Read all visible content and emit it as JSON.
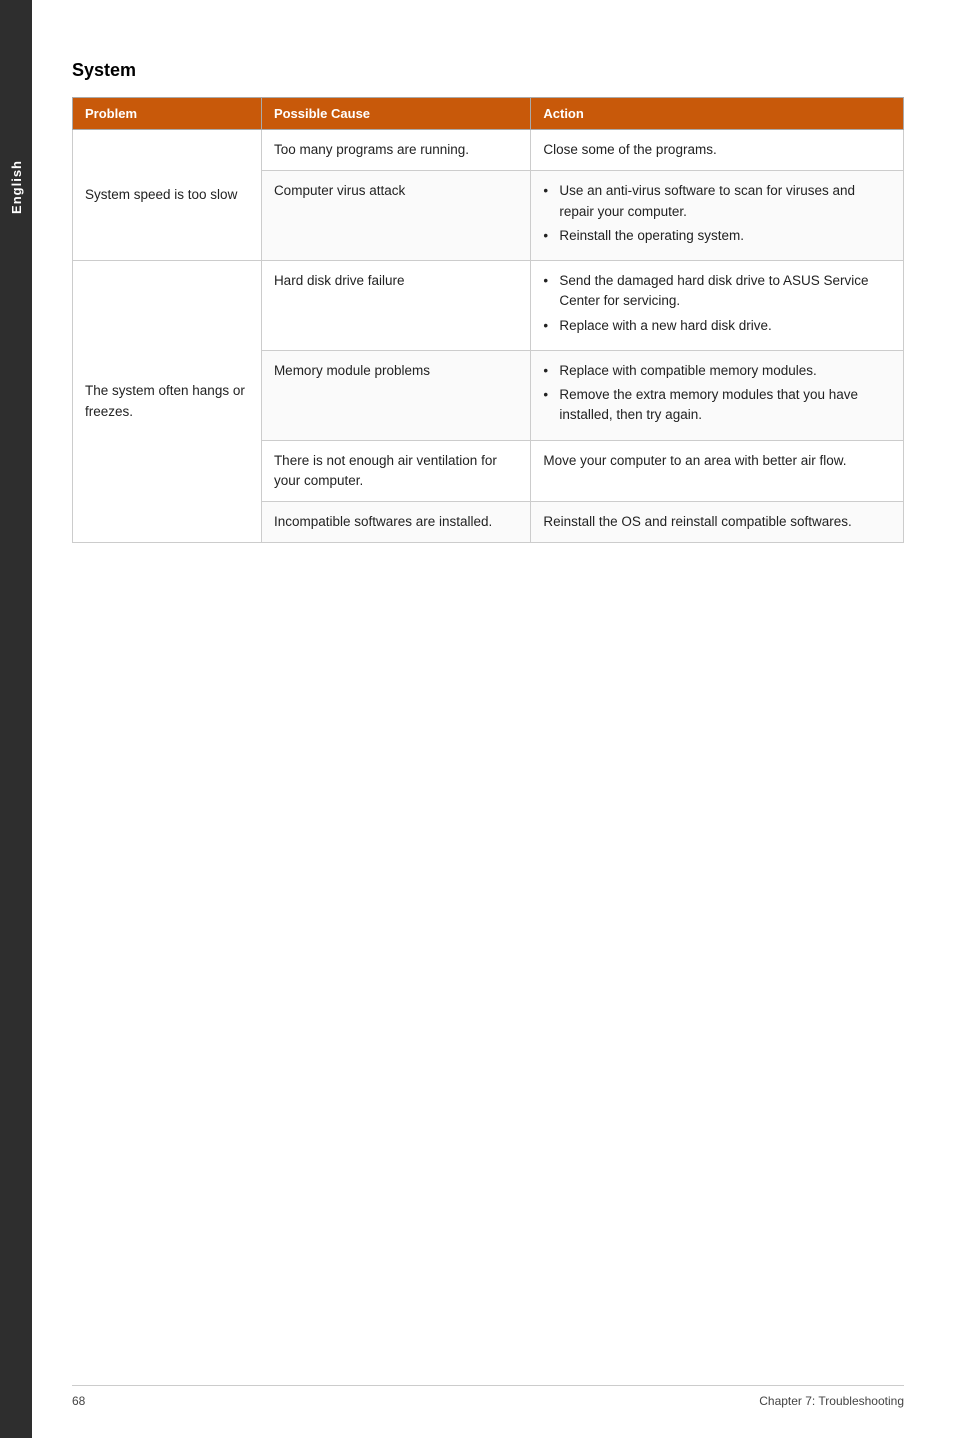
{
  "side_tab": {
    "label": "English"
  },
  "section_title": "System",
  "table": {
    "headers": [
      "Problem",
      "Possible Cause",
      "Action"
    ],
    "rows": [
      {
        "problem": "System speed is too slow",
        "possible_cause": "Too many programs are running.",
        "action_text": "Close some of the programs.",
        "action_type": "plain"
      },
      {
        "problem": "",
        "possible_cause": "Computer virus attack",
        "action_type": "bullets",
        "action_bullets": [
          "Use an anti-virus software to scan for viruses and repair your computer.",
          "Reinstall the operating system."
        ]
      },
      {
        "problem": "The system often hangs or freezes.",
        "possible_cause": "Hard disk drive failure",
        "action_type": "bullets",
        "action_bullets": [
          "Send the damaged hard disk drive to ASUS Service Center for servicing.",
          "Replace with a new hard disk drive."
        ]
      },
      {
        "problem": "",
        "possible_cause": "Memory module problems",
        "action_type": "bullets",
        "action_bullets": [
          "Replace with compatible memory modules.",
          "Remove the extra memory modules that you have installed, then try again."
        ]
      },
      {
        "problem": "",
        "possible_cause": "There is not enough air ventilation for your computer.",
        "action_text": "Move your computer to an area with better air flow.",
        "action_type": "plain"
      },
      {
        "problem": "",
        "possible_cause": "Incompatible softwares are installed.",
        "action_text": "Reinstall the OS and reinstall compatible softwares.",
        "action_type": "plain"
      }
    ]
  },
  "footer": {
    "page_number": "68",
    "chapter": "Chapter 7: Troubleshooting"
  }
}
